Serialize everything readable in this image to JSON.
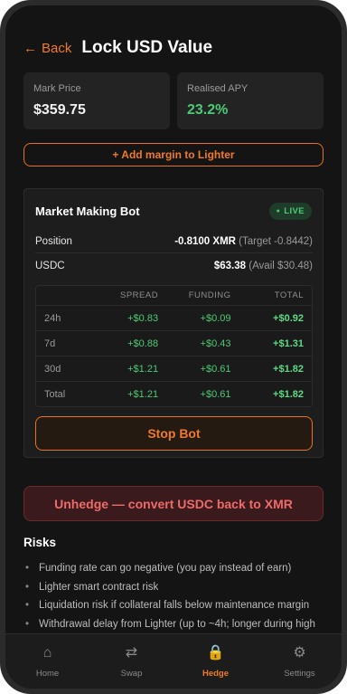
{
  "header": {
    "back_label": "Back",
    "back_arrow": "←",
    "title": "Lock USD Value"
  },
  "stats": [
    {
      "label": "Mark Price",
      "value": "$359.75"
    },
    {
      "label": "Realised APY",
      "value": "23.2%"
    }
  ],
  "add_margin_button": "+ Add margin to Lighter",
  "bot": {
    "title": "Market Making Bot",
    "status": "LIVE",
    "status_dot": "●",
    "position": {
      "label": "Position",
      "value": "-0.8100 XMR",
      "sub": "(Target -0.8442)"
    },
    "usdc": {
      "label": "USDC",
      "value": "$63.38",
      "sub": "(Avail $30.48)"
    },
    "pnl": {
      "headers": [
        "SPREAD",
        "FUNDING",
        "TOTAL"
      ],
      "rows": [
        {
          "period": "24h",
          "spread": "+$0.83",
          "funding": "+$0.09",
          "total": "+$0.92"
        },
        {
          "period": "7d",
          "spread": "+$0.88",
          "funding": "+$0.43",
          "total": "+$1.31"
        },
        {
          "period": "30d",
          "spread": "+$1.21",
          "funding": "+$0.61",
          "total": "+$1.82"
        },
        {
          "period": "Total",
          "spread": "+$1.21",
          "funding": "+$0.61",
          "total": "+$1.82"
        }
      ]
    },
    "stop_button": "Stop Bot"
  },
  "unhedge_button": "Unhedge — convert USDC back to XMR",
  "risks": {
    "title": "Risks",
    "items": [
      "Funding rate can go negative (you pay instead of earn)",
      "Lighter smart contract risk",
      "Liquidation risk if collateral falls below maintenance margin",
      "Withdrawal delay from Lighter (up to ~4h; longer during high"
    ]
  },
  "tabs": [
    {
      "label": "Home",
      "icon": "home-icon",
      "glyph": "⌂"
    },
    {
      "label": "Swap",
      "icon": "swap-icon",
      "glyph": "⇄"
    },
    {
      "label": "Hedge",
      "icon": "lock-icon",
      "glyph": "🔒",
      "active": true
    },
    {
      "label": "Settings",
      "icon": "gear-icon",
      "glyph": "⚙"
    }
  ],
  "colors": {
    "accent": "#f07a2a",
    "positive": "#4ccb76",
    "danger": "#ef6b6b",
    "background": "#141414"
  }
}
